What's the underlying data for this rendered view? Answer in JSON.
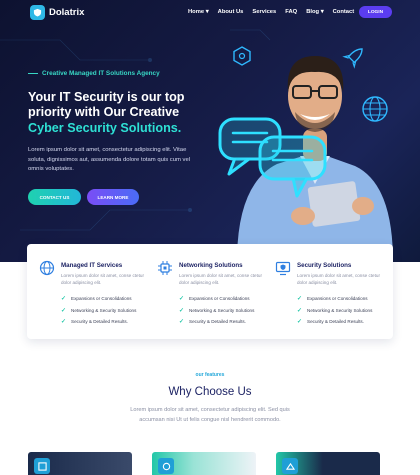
{
  "brand": {
    "name": "Dolatrix"
  },
  "nav": {
    "items": [
      "Home",
      "About Us",
      "Services",
      "FAQ",
      "Blog",
      "Contact"
    ],
    "dropdown_items": [
      0,
      4
    ],
    "login_label": "LOGIN"
  },
  "hero": {
    "tagline": "Creative Managed IT Solutions Agency",
    "heading_line1": "Your IT Security is our top",
    "heading_line2": "priority with Our Creative",
    "heading_accent": "Cyber Security Solutions.",
    "description": "Lorem ipsum dolor sit amet, consectetur adipiscing elit. Vitae soluta, dignissimos aut, assumenda dolore totam quis cum vel omnis voluptates.",
    "contact_label": "CONTACT US",
    "learn_label": "LEARN MORE"
  },
  "services": [
    {
      "title": "Managed IT Services",
      "text": "Lorem ipsum dolor sit amet, conse ctetur dolor adipiscing elit.",
      "items": [
        "Expansions or Consolidations",
        "Networking & Security Solutions",
        "Security & Detailed Results."
      ],
      "icon": "globe-network-icon"
    },
    {
      "title": "Networking Solutions",
      "text": "Lorem ipsum dolor sit amet, conse ctetur dolor adipiscing elit.",
      "items": [
        "Expansions or Consolidations",
        "Networking & Security Solutions",
        "Security & Detailed Results."
      ],
      "icon": "chip-network-icon"
    },
    {
      "title": "Security Solutions",
      "text": "Lorem ipsum dolor sit amet, conse ctetur dolor adipiscing elit.",
      "items": [
        "Expansions or Consolidations",
        "Networking & Security Solutions",
        "Security & Detailed Results."
      ],
      "icon": "secure-monitor-icon"
    }
  ],
  "features": {
    "label": "our features",
    "title": "Why Choose Us",
    "description": "Lorem ipsum dolor sit amet, consectetur adipiscing elit. Sed quis accumsan nisi Ut ut felis congue nisl hendrerit commodo."
  },
  "colors": {
    "hero_bg": "#151b45",
    "accent_teal": "#2ee0d4",
    "login_purple": "#5b3df0",
    "heading_navy": "#1d2364",
    "check_green": "#22c7a8"
  }
}
